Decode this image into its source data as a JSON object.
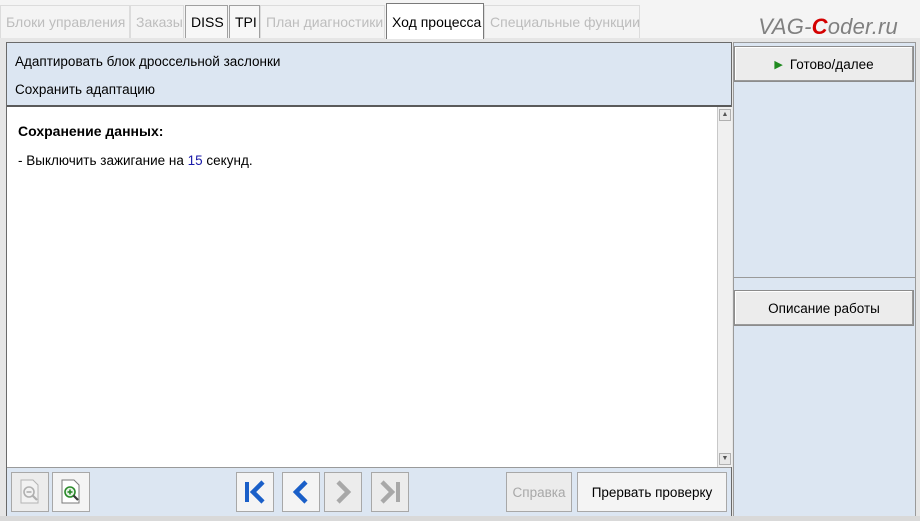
{
  "tabs": [
    {
      "label": "Блоки управления",
      "state": "disabled"
    },
    {
      "label": "Заказы",
      "state": "disabled"
    },
    {
      "label": "DISS",
      "state": "enabled"
    },
    {
      "label": "TPI",
      "state": "enabled"
    },
    {
      "label": "План диагностики",
      "state": "disabled"
    },
    {
      "label": "Ход процесса",
      "state": "active"
    },
    {
      "label": "Специальные функции",
      "state": "disabled"
    }
  ],
  "watermark": {
    "prefix": "VAG-",
    "accent": "C",
    "suffix": "oder.ru"
  },
  "header": {
    "line1": "Адаптировать блок дроссельной заслонки",
    "line2": "Сохранить адаптацию"
  },
  "content": {
    "title": "Сохранение данных:",
    "text_before": "- Выключить зажигание на ",
    "highlight": "15",
    "text_after": " секунд."
  },
  "toolbar": {
    "zoom_out_icon": "zoom-out-icon",
    "zoom_in_icon": "zoom-in-icon",
    "first_icon": "skip-first-icon",
    "prev_icon": "chevron-left-icon",
    "next_icon": "chevron-right-icon",
    "last_icon": "skip-last-icon",
    "help_label": "Справка",
    "abort_label": "Прервать проверку"
  },
  "sidebar": {
    "next_label": "Готово/далее",
    "next_icon": "play-icon",
    "description_label": "Описание работы"
  },
  "colors": {
    "panel_bg": "#dce6f2",
    "nav_blue": "#1a5fc8",
    "play_green": "#1f8a1f",
    "watermark_red": "#d40000"
  }
}
